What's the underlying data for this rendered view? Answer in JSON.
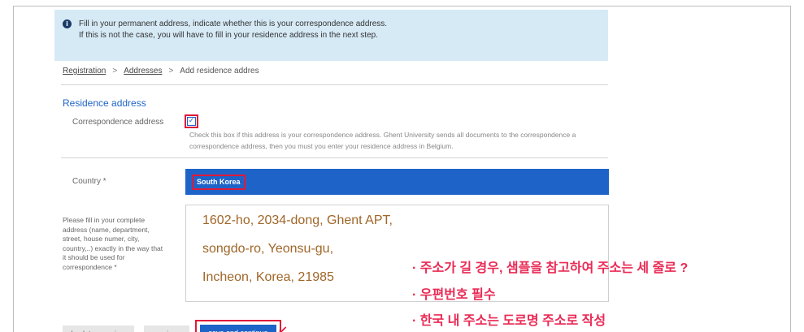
{
  "notice": {
    "line1": "Fill in your permanent address, indicate whether this is your correspondence address.",
    "line2": "If this is not the case, you will have to fill in your residence address in the next step."
  },
  "breadcrumb": {
    "items": [
      "Registration",
      "Addresses",
      "Add residence addres"
    ],
    "separator": ">"
  },
  "section_title": "Residence address",
  "correspondence": {
    "label": "Correspondence address",
    "checked": true,
    "help_line1": "Check this box if this address is your correspondence address. Ghent University sends all documents to the correspondence a",
    "help_line2": "correspondence address, then you must you enter your residence address in Belgium."
  },
  "country": {
    "label": "Country *",
    "value": "South Korea"
  },
  "address": {
    "label_lines": [
      "Please fill in your complete",
      "address (name, department,",
      "street, house numer, city,",
      "country,..) exactly in the way that",
      "it should be used for",
      "correspondence *"
    ],
    "value_lines": [
      "1602-ho, 2034-dong, Ghent APT,",
      "songdo-ro, Yeonsu-gu,",
      "Incheon, Korea, 21985"
    ]
  },
  "annotations": [
    "· 주소가 길 경우, 샘플을 참고하여 주소는 세 줄로 ?",
    "· 우편번호 필수",
    "· 한국 내 주소는 도로명 주소로 작성"
  ],
  "buttons": {
    "back": "back to overview",
    "previous": "previous",
    "save": "save and continue"
  },
  "colors": {
    "primary_blue": "#1e64c8",
    "notice_bg": "#d6eaf6",
    "highlight_red": "#e0193a",
    "annotation_pink": "#ea2a55",
    "address_text": "#a06628"
  }
}
